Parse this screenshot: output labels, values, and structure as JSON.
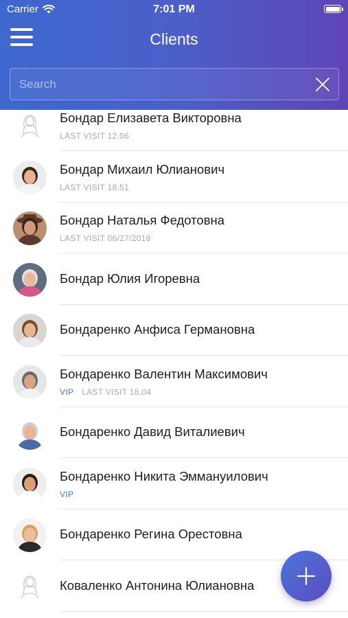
{
  "status_bar": {
    "carrier": "Carrier",
    "time": "7:01 PM"
  },
  "header": {
    "title": "Clients"
  },
  "search": {
    "placeholder": "Search",
    "value": ""
  },
  "clients": [
    {
      "name": "Бондар Елизавета Викторовна",
      "vip": "",
      "last_visit": "LAST VISIT 12.06",
      "avatar": "placeholder-avatar"
    },
    {
      "name": "Бондар Михаил Юлианович",
      "vip": "",
      "last_visit": "LAST VISIT 18:51",
      "avatar": "photo-avatar"
    },
    {
      "name": "Бондар Наталья Федотовна",
      "vip": "",
      "last_visit": "LAST VISIT 06/27/2018",
      "avatar": "photo-avatar"
    },
    {
      "name": "Бондар Юлия Игоревна",
      "vip": "",
      "last_visit": "",
      "avatar": "photo-avatar"
    },
    {
      "name": "Бондаренко Анфиса Германовна",
      "vip": "",
      "last_visit": "",
      "avatar": "photo-avatar"
    },
    {
      "name": "Бондаренко Валентин Максимович",
      "vip": "VIP",
      "last_visit": "LAST VISIT 18.04",
      "avatar": "photo-avatar"
    },
    {
      "name": "Бондаренко Давид Виталиевич",
      "vip": "",
      "last_visit": "",
      "avatar": "photo-avatar"
    },
    {
      "name": "Бондаренко Никита Эммануилович",
      "vip": "VIP",
      "last_visit": "",
      "avatar": "photo-avatar"
    },
    {
      "name": "Бондаренко Регина Орестовна",
      "vip": "",
      "last_visit": "",
      "avatar": "photo-avatar"
    },
    {
      "name": "Коваленко Антонина Юлиановна",
      "vip": "",
      "last_visit": "",
      "avatar": "placeholder-avatar"
    }
  ],
  "icons": {
    "menu": "hamburger-menu-icon",
    "clear": "close-icon",
    "fab": "plus-icon",
    "wifi": "wifi-icon",
    "battery": "battery-icon"
  },
  "colors": {
    "header_gradient_start": "#3d68cf",
    "header_gradient_end": "#5f45b8",
    "vip": "#4a76c9",
    "meta_text": "#a9a9a9"
  }
}
